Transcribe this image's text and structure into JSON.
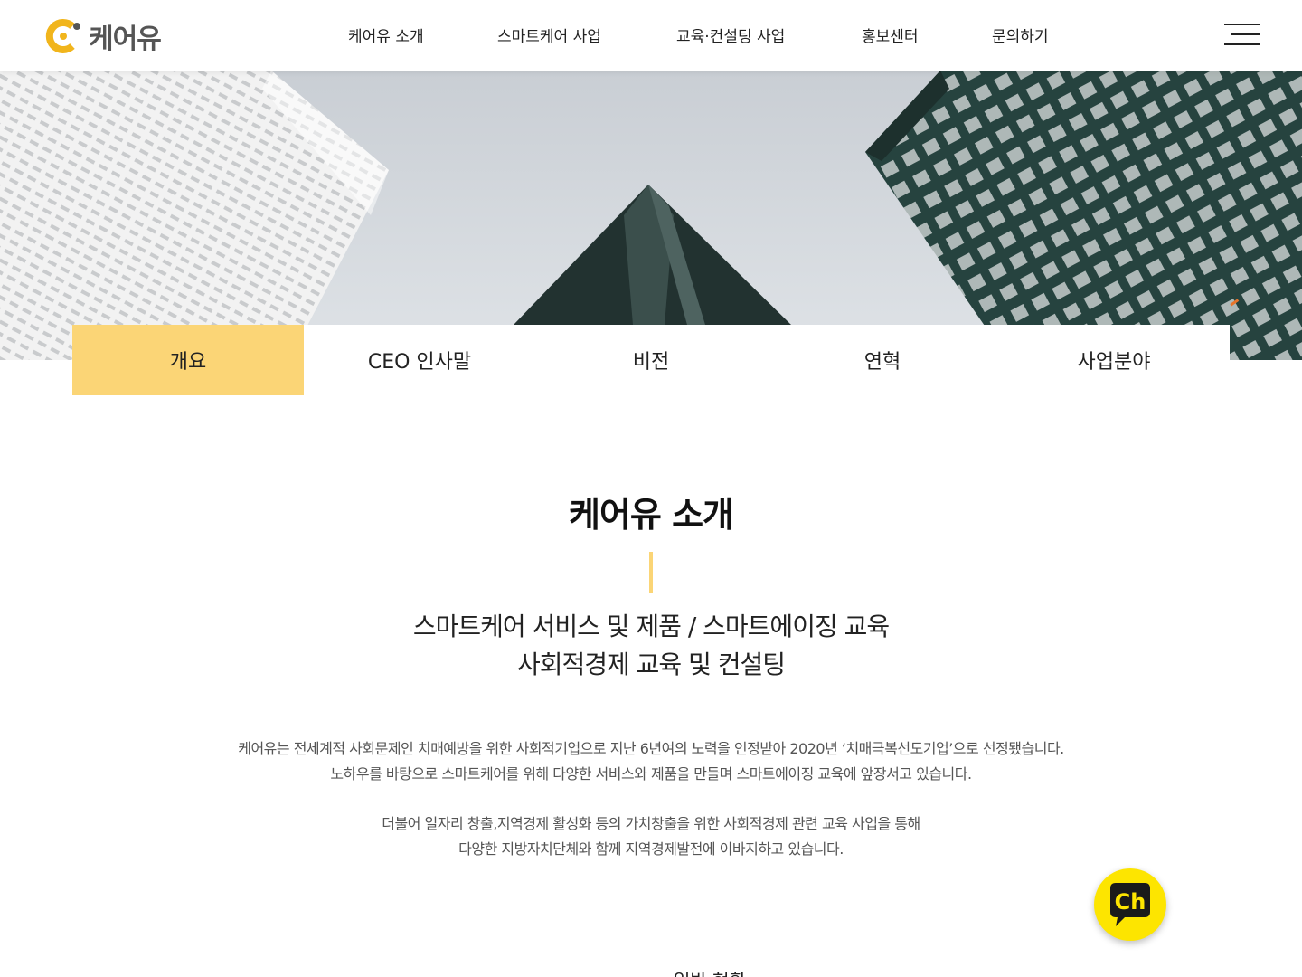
{
  "brand": {
    "name": "케어유",
    "accent": "#fbd576",
    "logo_color": "#f1b51c"
  },
  "nav": {
    "items": [
      {
        "label": "케어유 소개"
      },
      {
        "label": "스마트케어 사업"
      },
      {
        "label": "교육·컨설팅 사업"
      },
      {
        "label": "홍보센터"
      },
      {
        "label": "문의하기"
      }
    ],
    "menu_icon": "hamburger-icon"
  },
  "subtabs": {
    "items": [
      {
        "label": "개요",
        "active": true
      },
      {
        "label": "CEO 인사말",
        "active": false
      },
      {
        "label": "비전",
        "active": false
      },
      {
        "label": "연혁",
        "active": false
      },
      {
        "label": "사업분야",
        "active": false
      }
    ]
  },
  "content": {
    "title": "케어유 소개",
    "lead_line1": "스마트케어 서비스 및 제품 / 스마트에이징 교육",
    "lead_line2": "사회적경제 교육 및 컨설팅",
    "para1_line1": "케어유는 전세계적 사회문제인 치매예방을 위한 사회적기업으로 지난 6년여의 노력을 인정받아 2020년 ‘치매극복선도기업’으로 선정됐습니다.",
    "para1_line2": "노하우를 바탕으로 스마트케어를 위해 다양한 서비스와 제품을 만들며 스마트에이징 교육에 앞장서고 있습니다.",
    "para2_line1": "더불어 일자리 창출,지역경제 활성화 등의 가치창출을 위한 사회적경제 관련 교육 사업을 통해",
    "para2_line2": "다양한 지방자치단체와 함께 지역경제발전에 이바지하고 있습니다.",
    "cut_heading": "일반 현황"
  },
  "chat_button": {
    "label": "Ch",
    "color": "#fde500",
    "icon": "kakao-channel-icon"
  }
}
